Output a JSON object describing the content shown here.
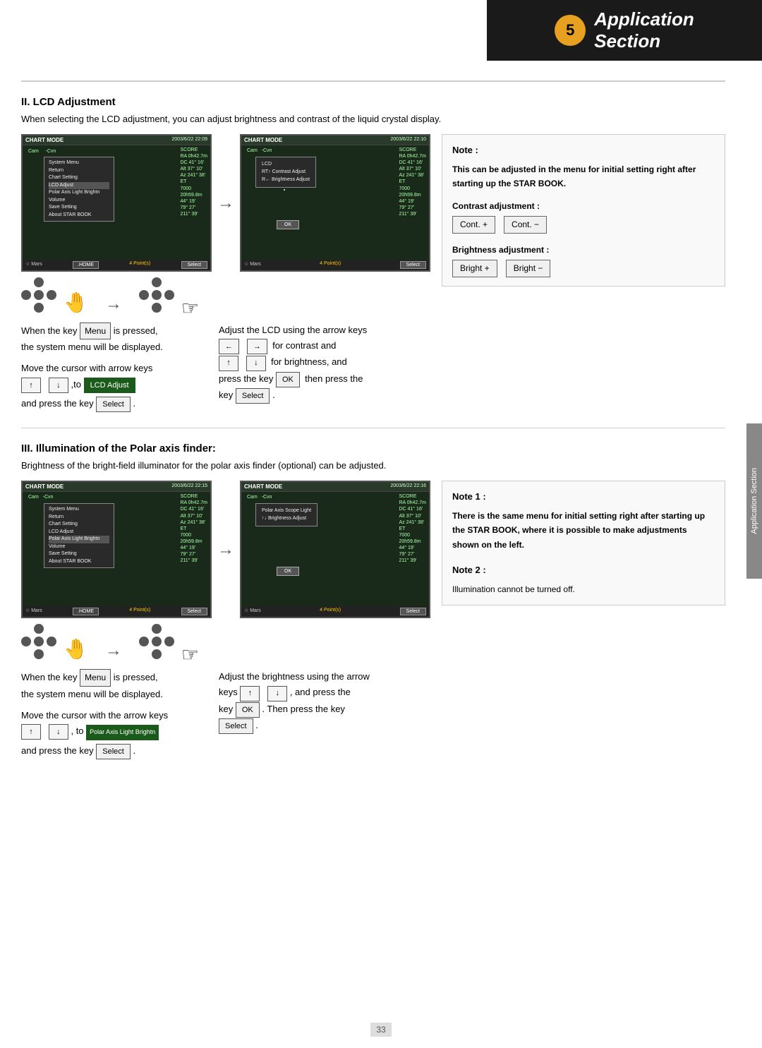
{
  "header": {
    "circle_num": "5",
    "title_line1": "Application",
    "title_line2": "Section"
  },
  "side_tab": {
    "label": "Application Section"
  },
  "section2": {
    "title": "II. LCD Adjustment",
    "description": "When selecting the LCD adjustment, you can adjust brightness and contrast of the liquid crystal display.",
    "screen1_title": "CHART MODE",
    "screen1_date": "2003/6/22 22:09",
    "screen1_cam": "Cam",
    "screen1_cvn": "-Cvn",
    "screen2_title": "CHART MODE",
    "screen2_date": "2003/6/22 22:10",
    "screen2_cam": "Cam",
    "screen2_cvn": "-Cvn",
    "menu_items": [
      "System Menu",
      "Return",
      "Chart Setting",
      "LCD Adjust",
      "Polar Axis Light Brightn",
      "Volume",
      "Save Setting",
      "About STAR BOOK"
    ],
    "dialog_lines": [
      "LCD",
      "RT↑ Contrast Adjust",
      "R←  Brightness Adjust"
    ],
    "ok_label": "OK",
    "select_label": "Select",
    "home_label": ".HOME",
    "text1": "When the key",
    "key_menu": "Menu",
    "text2": "is pressed,",
    "text3": "the system menu will be displayed.",
    "text4": "Adjust the LCD using the arrow keys",
    "text5_left": "←",
    "text5_right": "→",
    "text6": "for contrast and",
    "text7_up": "↑",
    "text7_down": "↓",
    "text8": "for brightness, and",
    "text9": "Move the cursor with arrow keys",
    "text10_up": "↑",
    "text10_down": "↓",
    "text11": ",to",
    "key_lcd": "LCD Adjust",
    "text12": "and press the key",
    "key_select1": "Select",
    "text13": "press the key",
    "key_ok": "OK",
    "text14": "then press the",
    "key_select2": "Select",
    "note_title": "Note :",
    "note_body": "This can be adjusted in the menu for initial setting right after starting up the STAR BOOK.",
    "contrast_label": "Contrast adjustment :",
    "cont_plus": "Cont. +",
    "cont_minus": "Cont. −",
    "brightness_label": "Brightness adjustment :",
    "bright_plus": "Bright +",
    "bright_minus": "Bright −"
  },
  "section3": {
    "title": "III. Illumination of the Polar axis finder:",
    "description": "Brightness of the bright-field illuminator for the polar axis finder (optional) can be adjusted.",
    "screen1_title": "CHART MODE",
    "screen1_date": "2003/6/22 22:15",
    "screen2_title": "CHART MODE",
    "screen2_date": "2003/6/22 22:16",
    "menu_items": [
      "System Menu",
      "Return",
      "Chart Setting",
      "LCD Adjust",
      "Polar Axis Light Brightn",
      "Volume",
      "Save Setting",
      "About STAR BOOK"
    ],
    "dialog_lines": [
      "Polar Axis Scope Light",
      "↑↓ Brightness Adjust"
    ],
    "ok_label": "OK",
    "text1": "When the key",
    "key_menu": "Menu",
    "text2": "is pressed,",
    "text3": "the system menu will be displayed.",
    "text4": "Adjust the brightness using the arrow",
    "text5_keys": "keys",
    "key_up": "↑",
    "key_down": "↓",
    "text6": ", and press the",
    "text7": "key",
    "key_ok": "OK",
    "text8": ". Then press the key",
    "key_select": "Select",
    "text9": ".",
    "text10": "Move the cursor with the arrow keys",
    "key_up2": "↑",
    "key_down2": "↓",
    "text11": ", to",
    "key_polar": "Polar Axis Light Brightn",
    "text12": "and press the key",
    "key_select2": "Select",
    "text13": ".",
    "note1_title": "Note 1 :",
    "note1_body": "There is the same menu for initial setting right after starting up the STAR BOOK,  where it is possible to make adjustments shown on the left.",
    "note2_title": "Note 2 :",
    "note2_body": "Illumination cannot be turned off."
  },
  "page_number": "33"
}
